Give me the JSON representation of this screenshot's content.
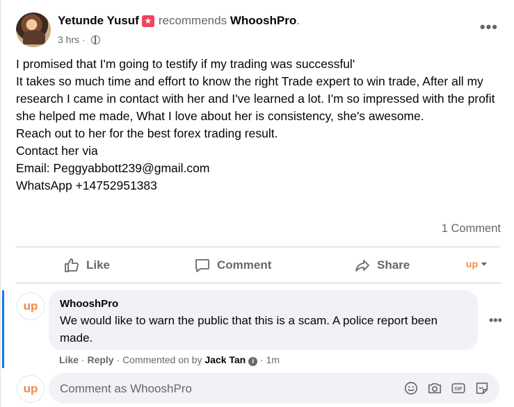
{
  "post": {
    "author": "Yetunde Yusuf",
    "recommends_text": "recommends",
    "page_name": "WhooshPro",
    "page_suffix": ".",
    "time": "3 hrs",
    "separator": "·",
    "more": "•••",
    "body_lines": [
      "I promised that I'm going to testify if my trading was successful'",
      "It takes so much time and effort to know the right Trade expert to win trade, After all my research I came in contact with her and I've learned a lot. I'm so impressed with the profit she helped me made, What I love about her is consistency, she's awesome.",
      "Reach out to her for the best forex trading result.",
      "Contact her via",
      "Email: Peggyabbott239@gmail.com",
      "WhatsApp +14752951383"
    ],
    "comment_count": "1 Comment"
  },
  "actions": {
    "like": "Like",
    "comment": "Comment",
    "share": "Share",
    "page_selector": "up"
  },
  "comment": {
    "author": "WhooshPro",
    "text": "We would like to warn the public that this is a scam. A police report been made.",
    "more": "•••",
    "like": "Like",
    "dot": "·",
    "reply": "Reply",
    "commented_on_by": "Commented on by",
    "commenter": "Jack Tan",
    "time": "1m"
  },
  "avatar_text": "up",
  "composer": {
    "placeholder": "Comment as WhooshPro"
  },
  "colors": {
    "accent_blue": "#1877f2",
    "secondary_text": "#65676b",
    "bubble_bg": "#f0f2f5",
    "brand_orange": "#f08a49",
    "badge_pink": "#f3425f"
  }
}
